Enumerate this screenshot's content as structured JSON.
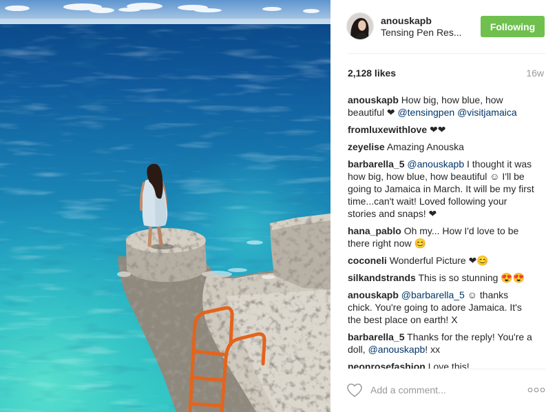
{
  "header": {
    "username": "anouskapb",
    "location": "Tensing Pen Res...",
    "follow_button": "Following"
  },
  "stats": {
    "likes": "2,128 likes",
    "age": "16w"
  },
  "comments": [
    {
      "user": "anouskapb",
      "parts": [
        "How big, how blue, how beautiful ❤",
        "@tensingpen",
        "@visitjamaica"
      ]
    },
    {
      "user": "fromluxewithlove",
      "parts": [
        "❤❤"
      ]
    },
    {
      "user": "zeyelise",
      "parts": [
        "Amazing Anouska"
      ]
    },
    {
      "user": "barbarella_5",
      "parts": [
        "@anouskapb",
        "I thought it was how big, how blue, how beautiful ☺ I'll be going to Jamaica in March. It will be my first time...can't wait! Loved following your stories and snaps! ❤"
      ]
    },
    {
      "user": "hana_pablo",
      "parts": [
        "Oh my... How I'd love to be there right now 😊"
      ]
    },
    {
      "user": "coconeli",
      "parts": [
        "Wonderful Picture ❤😊"
      ]
    },
    {
      "user": "silkandstrands",
      "parts": [
        "This is so stunning 😍😍"
      ]
    },
    {
      "user": "anouskapb",
      "parts": [
        "@barbarella_5",
        "☺ thanks chick. You're going to adore Jamaica. It's the best place on earth! X"
      ]
    },
    {
      "user": "barbarella_5",
      "parts": [
        "Thanks for the reply! You're a doll,",
        "@anouskapb",
        "! xx"
      ]
    },
    {
      "user": "neonrosefashion",
      "parts": [
        "Love this!"
      ]
    }
  ],
  "comment_box": {
    "placeholder": "Add a comment..."
  },
  "icons": {
    "like": "heart-outline-icon",
    "more": "more-options-icon"
  },
  "colors": {
    "text": "#262626",
    "muted": "#999999",
    "mention": "#003569",
    "follow_button": "#70c050",
    "divider": "#efefef"
  }
}
